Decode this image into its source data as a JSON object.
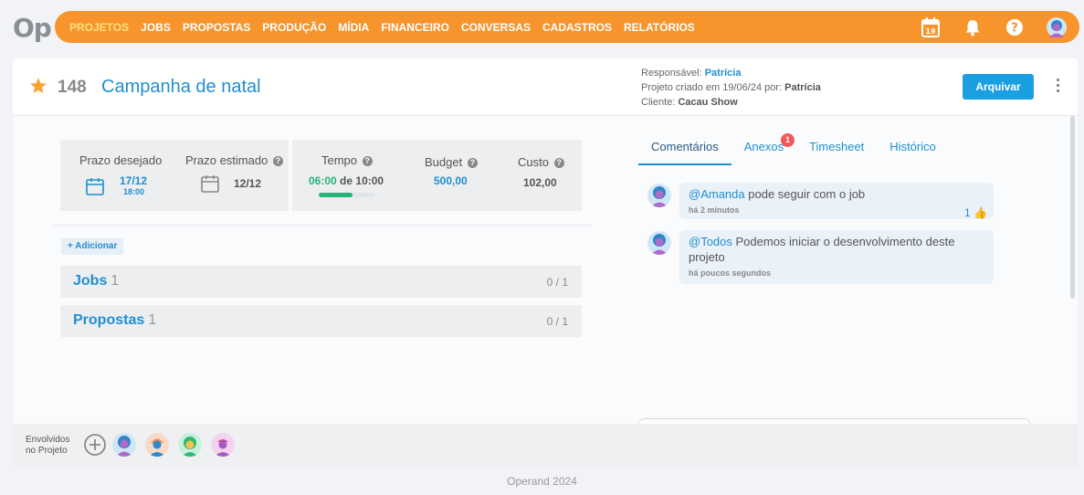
{
  "app": {
    "logo": "Op"
  },
  "nav": {
    "items": [
      "PROJETOS",
      "JOBS",
      "PROPOSTAS",
      "PRODUÇÃO",
      "MÍDIA",
      "FINANCEIRO",
      "CONVERSAS",
      "CADASTROS",
      "RELATÓRIOS"
    ],
    "active": "PROJETOS",
    "calendar_day": "19"
  },
  "project": {
    "number": "148",
    "title": "Campanha de natal",
    "responsible_label": "Responsável:",
    "responsible": "Patrícia",
    "created_label": "Projeto criado em 19/06/24 por:",
    "created_by": "Patrícia",
    "client_label": "Cliente:",
    "client": "Cacau Show",
    "archive_label": "Arquivar"
  },
  "stats": {
    "desired_label": "Prazo desejado",
    "desired_date": "17/12",
    "desired_time": "18:00",
    "estimated_label": "Prazo estimado",
    "estimated_date": "12/12",
    "time_label": "Tempo",
    "time_spent": "06:00",
    "time_of": "de",
    "time_total": "10:00",
    "time_progress": 0.6,
    "budget_label": "Budget",
    "budget_value": "500,00",
    "cost_label": "Custo",
    "cost_value": "102,00"
  },
  "add_label": "+ Adicionar",
  "sections": [
    {
      "title": "Jobs",
      "count": "1",
      "ratio": "0 / 1"
    },
    {
      "title": "Propostas",
      "count": "1",
      "ratio": "0 / 1"
    }
  ],
  "tabs": {
    "comments": "Comentários",
    "attachments": "Anexos",
    "attachments_badge": "1",
    "timesheet": "Timesheet",
    "history": "Histórico"
  },
  "comments": [
    {
      "mention": "@Amanda",
      "text": "pode seguir com o job",
      "time": "há 2 minutos",
      "likes": "1"
    },
    {
      "mention": "@Todos",
      "text": "Podemos iniciar o desenvolvimento deste projeto",
      "time": "há poucos segundos"
    }
  ],
  "footer": {
    "involved_line1": "Envolvidos",
    "involved_line2": "no Projeto",
    "copyright": "Operand 2024"
  },
  "colors": {
    "accent": "#f7942c",
    "link": "#1f8fd0",
    "primary_button": "#1a9fe0",
    "progress": "#26b57a",
    "badge": "#f05a5a"
  }
}
